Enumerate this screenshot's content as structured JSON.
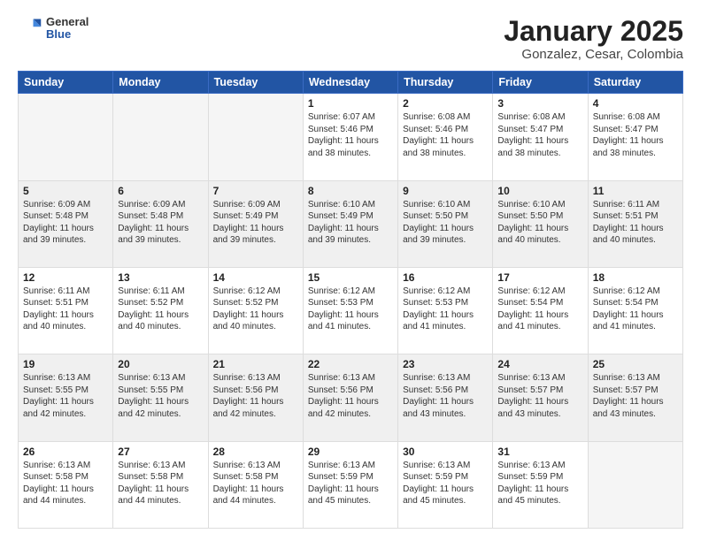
{
  "header": {
    "logo_general": "General",
    "logo_blue": "Blue",
    "title": "January 2025",
    "subtitle": "Gonzalez, Cesar, Colombia"
  },
  "days_of_week": [
    "Sunday",
    "Monday",
    "Tuesday",
    "Wednesday",
    "Thursday",
    "Friday",
    "Saturday"
  ],
  "weeks": [
    {
      "shade": false,
      "days": [
        {
          "num": "",
          "info": ""
        },
        {
          "num": "",
          "info": ""
        },
        {
          "num": "",
          "info": ""
        },
        {
          "num": "1",
          "info": "Sunrise: 6:07 AM\nSunset: 5:46 PM\nDaylight: 11 hours\nand 38 minutes."
        },
        {
          "num": "2",
          "info": "Sunrise: 6:08 AM\nSunset: 5:46 PM\nDaylight: 11 hours\nand 38 minutes."
        },
        {
          "num": "3",
          "info": "Sunrise: 6:08 AM\nSunset: 5:47 PM\nDaylight: 11 hours\nand 38 minutes."
        },
        {
          "num": "4",
          "info": "Sunrise: 6:08 AM\nSunset: 5:47 PM\nDaylight: 11 hours\nand 38 minutes."
        }
      ]
    },
    {
      "shade": true,
      "days": [
        {
          "num": "5",
          "info": "Sunrise: 6:09 AM\nSunset: 5:48 PM\nDaylight: 11 hours\nand 39 minutes."
        },
        {
          "num": "6",
          "info": "Sunrise: 6:09 AM\nSunset: 5:48 PM\nDaylight: 11 hours\nand 39 minutes."
        },
        {
          "num": "7",
          "info": "Sunrise: 6:09 AM\nSunset: 5:49 PM\nDaylight: 11 hours\nand 39 minutes."
        },
        {
          "num": "8",
          "info": "Sunrise: 6:10 AM\nSunset: 5:49 PM\nDaylight: 11 hours\nand 39 minutes."
        },
        {
          "num": "9",
          "info": "Sunrise: 6:10 AM\nSunset: 5:50 PM\nDaylight: 11 hours\nand 39 minutes."
        },
        {
          "num": "10",
          "info": "Sunrise: 6:10 AM\nSunset: 5:50 PM\nDaylight: 11 hours\nand 40 minutes."
        },
        {
          "num": "11",
          "info": "Sunrise: 6:11 AM\nSunset: 5:51 PM\nDaylight: 11 hours\nand 40 minutes."
        }
      ]
    },
    {
      "shade": false,
      "days": [
        {
          "num": "12",
          "info": "Sunrise: 6:11 AM\nSunset: 5:51 PM\nDaylight: 11 hours\nand 40 minutes."
        },
        {
          "num": "13",
          "info": "Sunrise: 6:11 AM\nSunset: 5:52 PM\nDaylight: 11 hours\nand 40 minutes."
        },
        {
          "num": "14",
          "info": "Sunrise: 6:12 AM\nSunset: 5:52 PM\nDaylight: 11 hours\nand 40 minutes."
        },
        {
          "num": "15",
          "info": "Sunrise: 6:12 AM\nSunset: 5:53 PM\nDaylight: 11 hours\nand 41 minutes."
        },
        {
          "num": "16",
          "info": "Sunrise: 6:12 AM\nSunset: 5:53 PM\nDaylight: 11 hours\nand 41 minutes."
        },
        {
          "num": "17",
          "info": "Sunrise: 6:12 AM\nSunset: 5:54 PM\nDaylight: 11 hours\nand 41 minutes."
        },
        {
          "num": "18",
          "info": "Sunrise: 6:12 AM\nSunset: 5:54 PM\nDaylight: 11 hours\nand 41 minutes."
        }
      ]
    },
    {
      "shade": true,
      "days": [
        {
          "num": "19",
          "info": "Sunrise: 6:13 AM\nSunset: 5:55 PM\nDaylight: 11 hours\nand 42 minutes."
        },
        {
          "num": "20",
          "info": "Sunrise: 6:13 AM\nSunset: 5:55 PM\nDaylight: 11 hours\nand 42 minutes."
        },
        {
          "num": "21",
          "info": "Sunrise: 6:13 AM\nSunset: 5:56 PM\nDaylight: 11 hours\nand 42 minutes."
        },
        {
          "num": "22",
          "info": "Sunrise: 6:13 AM\nSunset: 5:56 PM\nDaylight: 11 hours\nand 42 minutes."
        },
        {
          "num": "23",
          "info": "Sunrise: 6:13 AM\nSunset: 5:56 PM\nDaylight: 11 hours\nand 43 minutes."
        },
        {
          "num": "24",
          "info": "Sunrise: 6:13 AM\nSunset: 5:57 PM\nDaylight: 11 hours\nand 43 minutes."
        },
        {
          "num": "25",
          "info": "Sunrise: 6:13 AM\nSunset: 5:57 PM\nDaylight: 11 hours\nand 43 minutes."
        }
      ]
    },
    {
      "shade": false,
      "days": [
        {
          "num": "26",
          "info": "Sunrise: 6:13 AM\nSunset: 5:58 PM\nDaylight: 11 hours\nand 44 minutes."
        },
        {
          "num": "27",
          "info": "Sunrise: 6:13 AM\nSunset: 5:58 PM\nDaylight: 11 hours\nand 44 minutes."
        },
        {
          "num": "28",
          "info": "Sunrise: 6:13 AM\nSunset: 5:58 PM\nDaylight: 11 hours\nand 44 minutes."
        },
        {
          "num": "29",
          "info": "Sunrise: 6:13 AM\nSunset: 5:59 PM\nDaylight: 11 hours\nand 45 minutes."
        },
        {
          "num": "30",
          "info": "Sunrise: 6:13 AM\nSunset: 5:59 PM\nDaylight: 11 hours\nand 45 minutes."
        },
        {
          "num": "31",
          "info": "Sunrise: 6:13 AM\nSunset: 5:59 PM\nDaylight: 11 hours\nand 45 minutes."
        },
        {
          "num": "",
          "info": ""
        }
      ]
    }
  ]
}
